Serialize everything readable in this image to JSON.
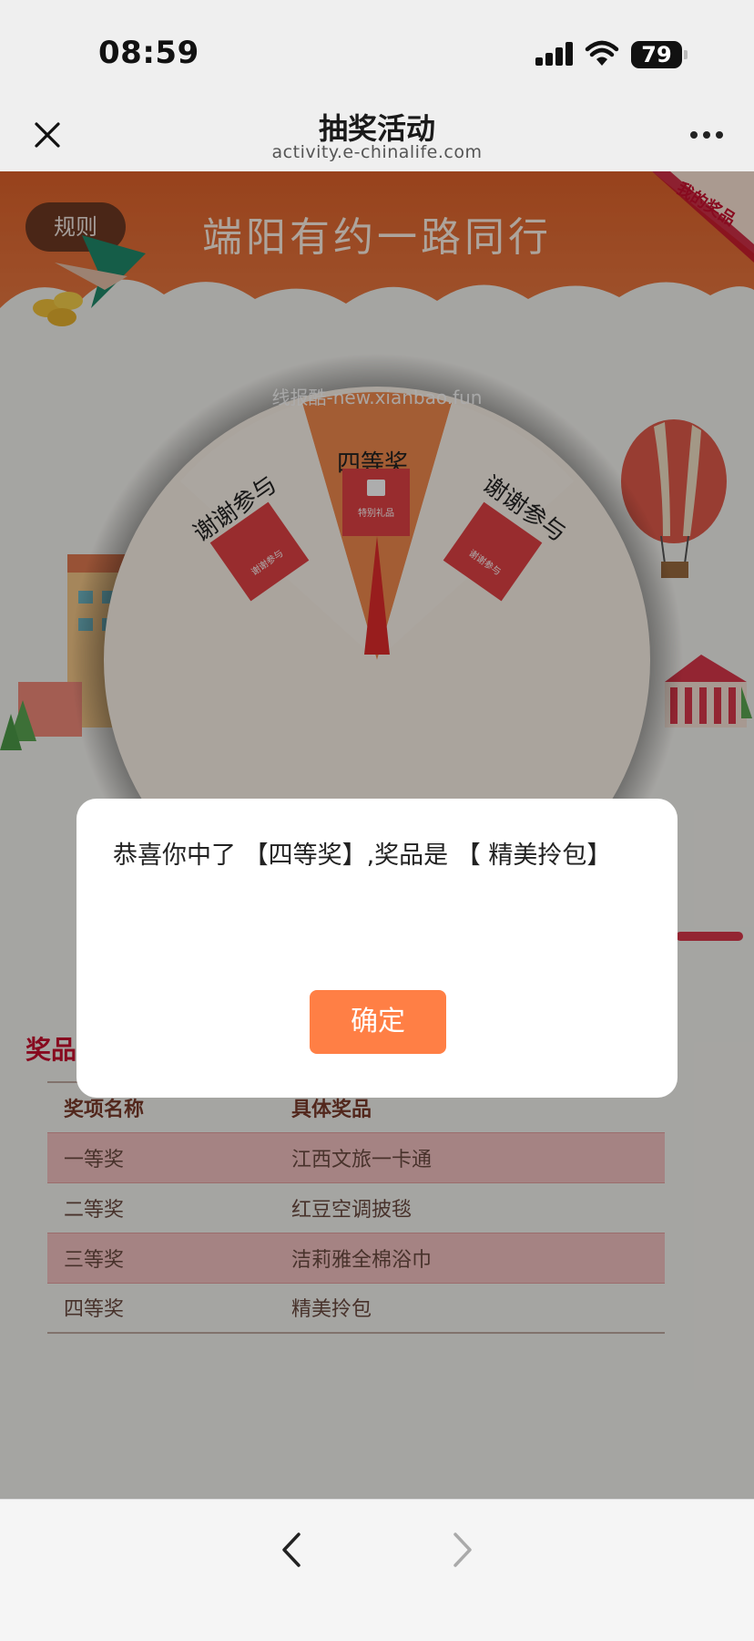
{
  "status_bar": {
    "time": "08:59",
    "battery": "79",
    "icons": [
      "signal-icon",
      "wifi-icon",
      "battery-icon"
    ]
  },
  "nav": {
    "title": "抽奖活动",
    "url": "activity.e-chinalife.com",
    "icons": [
      "close-icon",
      "more-icon"
    ]
  },
  "page": {
    "banner_title": "端阳有约一路同行",
    "rules_label": "规则",
    "my_prizes_label": "我的奖品",
    "watermark": "线报酷-new.xianbao.fun",
    "wheel": {
      "segments": [
        {
          "label": "谢谢参与",
          "card": "谢谢参与"
        },
        {
          "label": "四等奖",
          "card": "特别礼品"
        },
        {
          "label": "谢谢参与",
          "card": "谢谢参与"
        }
      ]
    },
    "prize_section": {
      "title": "奖品说明",
      "columns": [
        "奖项名称",
        "具体奖品"
      ],
      "rows": [
        {
          "tier": "一等奖",
          "prize": "江西文旅一卡通"
        },
        {
          "tier": "二等奖",
          "prize": "红豆空调披毯"
        },
        {
          "tier": "三等奖",
          "prize": "洁莉雅全棉浴巾"
        },
        {
          "tier": "四等奖",
          "prize": "精美拎包"
        }
      ]
    }
  },
  "dialog": {
    "message": "恭喜你中了 【四等奖】,奖品是 【 精美拎包】",
    "confirm_label": "确定"
  },
  "toolbar": {
    "icons": [
      "back-icon",
      "forward-icon"
    ]
  },
  "colors": {
    "accent": "#ff7f45",
    "banner": "#e0622a",
    "prize_title": "#c8102e",
    "table_stripe": "#f4c2c2"
  }
}
